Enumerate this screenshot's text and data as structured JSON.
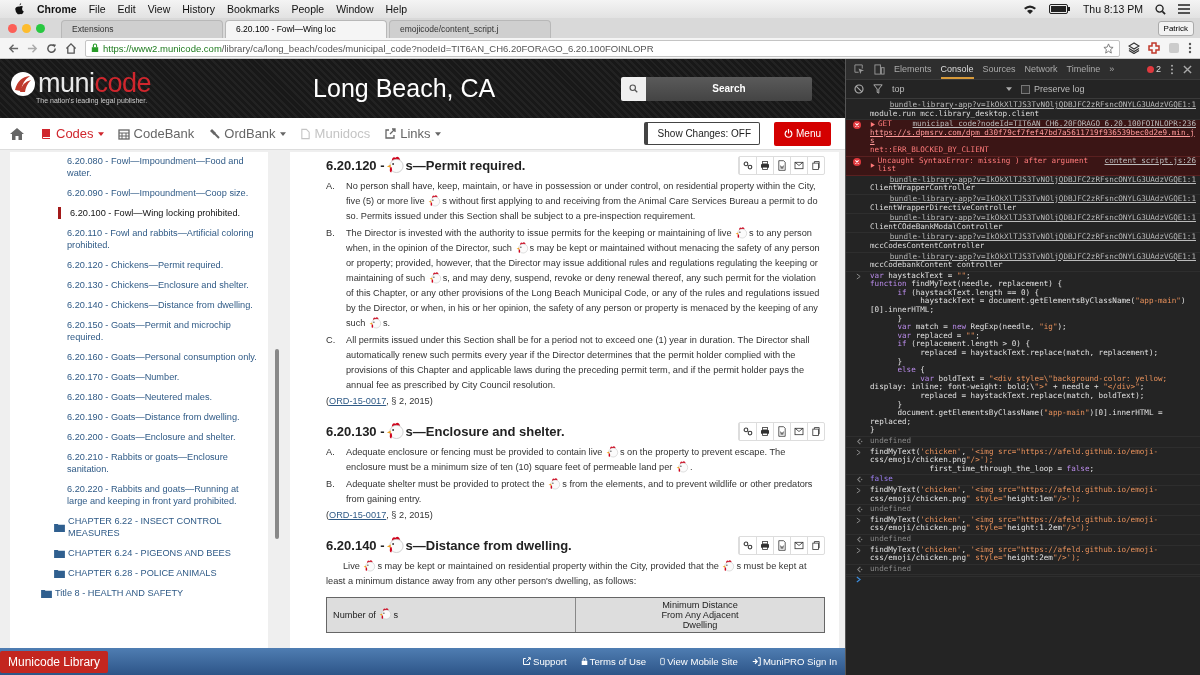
{
  "menu_bar": {
    "app": "Chrome",
    "items": [
      "File",
      "Edit",
      "View",
      "History",
      "Bookmarks",
      "People",
      "Window",
      "Help"
    ],
    "clock": "Thu 8:13 PM"
  },
  "browser": {
    "tabs": [
      {
        "label": "Extensions",
        "selected": false
      },
      {
        "label": "6.20.100 - Fowl—Wing loc",
        "selected": true
      },
      {
        "label": "emojicode/content_script.j",
        "selected": false
      }
    ],
    "profile": "Patrick",
    "url_host": "https://www2.municode.com",
    "url_path": "/library/ca/long_beach/codes/municipal_code?nodeId=TIT6AN_CH6.20FORAGO_6.20.100FOINLOPR"
  },
  "site": {
    "logo_a": "muni",
    "logo_b": "code",
    "tagline": "The nation's leading legal publisher.",
    "title": "Long Beach, CA",
    "search_button": "Search",
    "nav": [
      {
        "label": "Codes",
        "kind": "book",
        "disabled": false,
        "dropdown": true,
        "active": true
      },
      {
        "label": "CodeBank",
        "kind": "calendar",
        "disabled": false,
        "dropdown": false,
        "active": false
      },
      {
        "label": "OrdBank",
        "kind": "gavel",
        "disabled": false,
        "dropdown": true,
        "active": false
      },
      {
        "label": "Munidocs",
        "kind": "file",
        "disabled": true,
        "dropdown": false,
        "active": false
      },
      {
        "label": "Links",
        "kind": "link",
        "disabled": false,
        "dropdown": true,
        "active": false
      }
    ],
    "show_changes": "Show Changes: OFF",
    "menu_button": "Menu",
    "sidebar": [
      {
        "kind": "section",
        "label": "6.20.080 - Fowl—Impoundment—Food and water.",
        "selected": false
      },
      {
        "kind": "section",
        "label": "6.20.090 - Fowl—Impoundment—Coop size.",
        "selected": false
      },
      {
        "kind": "section",
        "label": "6.20.100 - Fowl—Wing locking prohibited.",
        "selected": true
      },
      {
        "kind": "section",
        "label": "6.20.110 - Fowl and rabbits—Artificial coloring prohibited.",
        "selected": false
      },
      {
        "kind": "section",
        "label": "6.20.120 - Chickens—Permit required.",
        "selected": false
      },
      {
        "kind": "section",
        "label": "6.20.130 - Chickens—Enclosure and shelter.",
        "selected": false
      },
      {
        "kind": "section",
        "label": "6.20.140 - Chickens—Distance from dwelling.",
        "selected": false
      },
      {
        "kind": "section",
        "label": "6.20.150 - Goats—Permit and microchip required.",
        "selected": false
      },
      {
        "kind": "section",
        "label": "6.20.160 - Goats—Personal consumption only.",
        "selected": false
      },
      {
        "kind": "section",
        "label": "6.20.170 - Goats—Number.",
        "selected": false
      },
      {
        "kind": "section",
        "label": "6.20.180 - Goats—Neutered males.",
        "selected": false
      },
      {
        "kind": "section",
        "label": "6.20.190 - Goats—Distance from dwelling.",
        "selected": false
      },
      {
        "kind": "section",
        "label": "6.20.200 - Goats—Enclosure and shelter.",
        "selected": false
      },
      {
        "kind": "section",
        "label": "6.20.210 - Rabbits or goats—Enclosure sanitation.",
        "selected": false
      },
      {
        "kind": "section",
        "label": "6.20.220 - Rabbits and goats—Running at large and keeping in front yard prohibited.",
        "selected": false
      },
      {
        "kind": "chapter",
        "label": "CHAPTER 6.22 - INSECT CONTROL MEASURES",
        "selected": false
      },
      {
        "kind": "chapter",
        "label": "CHAPTER 6.24 - PIGEONS AND BEES",
        "selected": false
      },
      {
        "kind": "chapter",
        "label": "CHAPTER 6.28 - POLICE ANIMALS",
        "selected": false
      },
      {
        "kind": "title",
        "label": "Title 8 - HEALTH AND SAFETY",
        "selected": false
      }
    ],
    "sections": [
      {
        "heading": [
          "6.20.120 - ",
          "s—Permit required."
        ],
        "paragraphs": [
          {
            "letter": "A.",
            "parts": [
              "No person shall have, keep, maintain, or have in possession or under control, on residential property within the City, five (5) or more live ",
              "s without first applying to and receiving from the Animal Care Services Bureau a permit to do so. Permits issued under this Section shall be subject to a pre-inspection requirement."
            ]
          },
          {
            "letter": "B.",
            "parts": [
              "The Director is invested with the authority to issue permits for the keeping or maintaining of live ",
              "s to any person when, in the opinion of the Director, such ",
              "s may be kept or maintained without menacing the safety of any person or property; provided, however, that the Director may issue additional rules and regulations regulating the keeping or maintaining of such ",
              "s, and may deny, suspend, revoke or deny renewal thereof, any such permit for the violation of this Chapter, or any other provisions of the Long Beach Municipal Code, or any of the rules and regulations issued by the Director, or when, in his or her opinion, the safety of any person or property is menaced by the keeping of any such ",
              "s."
            ]
          },
          {
            "letter": "C.",
            "parts": [
              "All permits issued under this Section shall be for a period not to exceed one (1) year in duration. The Director shall automatically renew such permits every year if the Director determines that the permit holder complied with the provisions of this Chapter and applicable laws during the preceding permit term, and if the permit holder pays the annual fee as prescribed by City Council resolution."
            ]
          }
        ],
        "citation": {
          "open": "(",
          "link": "ORD-15-0017",
          "rest": ", § 2, 2015)"
        }
      },
      {
        "heading": [
          "6.20.130 - ",
          "s—Enclosure and shelter."
        ],
        "paragraphs": [
          {
            "letter": "A.",
            "parts": [
              "Adequate enclosure or fencing must be provided to contain live ",
              "s on the property to prevent escape. The enclosure must be a minimum size of ten (10) square feet of permeable land per ",
              "."
            ]
          },
          {
            "letter": "B.",
            "parts": [
              "Adequate shelter must be provided to protect the ",
              "s from the elements, and to prevent wildlife or other predators from gaining entry."
            ]
          }
        ],
        "citation": {
          "open": "(",
          "link": "ORD-15-0017",
          "rest": ", § 2, 2015)"
        }
      },
      {
        "heading": [
          "6.20.140 - ",
          "s—Distance from dwelling."
        ],
        "intro": [
          "Live ",
          "s may be kept or maintained on residential property within the City, provided that the ",
          "s must be kept at least a minimum distance away from any other person's dwelling, as follows:"
        ],
        "table_header": [
          [
            "Number of ",
            "s"
          ],
          [
            "Minimum Distance From Any Adjacent Dwelling"
          ]
        ]
      }
    ],
    "footer": {
      "brand": "Municode Library",
      "links": [
        {
          "label": "Support",
          "kind": "external"
        },
        {
          "label": "Terms of Use",
          "kind": "lock"
        },
        {
          "label": "View Mobile Site",
          "kind": "phone"
        },
        {
          "label": "MuniPRO Sign In",
          "kind": "signin"
        }
      ]
    }
  },
  "devtools": {
    "tabs": [
      {
        "label": "Elements",
        "selected": false
      },
      {
        "label": "Console",
        "selected": true
      },
      {
        "label": "Sources",
        "selected": false
      },
      {
        "label": "Network",
        "selected": false
      },
      {
        "label": "Timeline",
        "selected": false
      }
    ],
    "more": "»",
    "error_count": "2",
    "context": "top",
    "preserve_log": {
      "label": "Preserve log",
      "checked": false
    },
    "console": [
      {
        "kind": "log",
        "source": "bundle-library-app?v=IkOkXlTJS3TvNOljQDBJFC2zRFsncONYLG3UAdzVGQE1:1",
        "text": "module.run mcc.library_desktop.client"
      },
      {
        "kind": "error",
        "text": "GET",
        "source": "municipal_code?nodeId=TIT6AN_CH6.20FORAGO_6.20.100FOINLOPR:236",
        "url": "https://s.dpmsrv.com/dpm_d30f79cf7fef47bd7a5611719f936539bec0d2e9.min.js",
        "message": "net::ERR_BLOCKED_BY_CLIENT"
      },
      {
        "kind": "error",
        "text": "Uncaught SyntaxError: missing ) after argument list",
        "source": "content_script.js:26"
      },
      {
        "kind": "log",
        "source": "bundle-library-app?v=IkOkXlTJS3TvNOljQDBJFC2zRFsncONYLG3UAdzVGQE1:1",
        "text": "ClientWrapperController"
      },
      {
        "kind": "log",
        "source": "bundle-library-app?v=IkOkXlTJS3TvNOljQDBJFC2zRFsncONYLG3UAdzVGQE1:1",
        "text": "ClientWrapperDirectiveController"
      },
      {
        "kind": "log",
        "source": "bundle-library-app?v=IkOkXlTJS3TvNOljQDBJFC2zRFsncONYLG3UAdzVGQE1:1",
        "text": "ClientCOdeBankModalController"
      },
      {
        "kind": "log",
        "source": "bundle-library-app?v=IkOkXlTJS3TvNOljQDBJFC2zRFsncONYLG3UAdzVGQE1:1",
        "text": "mccCodesContentController"
      },
      {
        "kind": "log",
        "source": "bundle-library-app?v=IkOkXlTJS3TvNOljQDBJFC2zRFsncONYLG3UAdzVGQE1:1",
        "text": "mccCodebankContent controller"
      },
      {
        "kind": "input",
        "lines": [
          "var haystackText = \"\";",
          "function findMyText(needle, replacement) {",
          "      if (haystackText.length == 0) {",
          "           haystackText = document.getElementsByClassName(\"app-main\")",
          "[0].innerHTML;",
          "      }",
          "      var match = new RegExp(needle, \"ig\");",
          "      var replaced = \"\";",
          "      if (replacement.length > 0) {",
          "           replaced = haystackText.replace(match, replacement);",
          "      }",
          "      else {",
          "           var boldText = \"<div style=\\\"background-color: yellow;",
          "display: inline; font-weight: bold;\\\">\" + needle + \"</div>\";",
          "           replaced = haystackText.replace(match, boldText);",
          "      }",
          "      document.getElementsByClassName(\"app-main\")[0].innerHTML =",
          "replaced;",
          "}"
        ]
      },
      {
        "kind": "result",
        "text": "undefined"
      },
      {
        "kind": "input",
        "lines": [
          "findMyText('chicken', '<img src=\"https://afeld.github.io/emoji-",
          "css/emoji/chicken.png\"/>');",
          "             first_time_through_the_loop = false;"
        ]
      },
      {
        "kind": "value",
        "text": "false"
      },
      {
        "kind": "input",
        "lines": [
          "findMyText('chicken', '<img src=\"https://afeld.github.io/emoji-",
          "css/emoji/chicken.png\" style=\"height:1em\"/>');"
        ]
      },
      {
        "kind": "result",
        "text": "undefined"
      },
      {
        "kind": "input",
        "lines": [
          "findMyText('chicken', '<img src=\"https://afeld.github.io/emoji-",
          "css/emoji/chicken.png\" style=\"height:1.2em\"/>');"
        ]
      },
      {
        "kind": "result",
        "text": "undefined"
      },
      {
        "kind": "input",
        "lines": [
          "findMyText('chicken', '<img src=\"https://afeld.github.io/emoji-",
          "css/emoji/chicken.png\" style=\"height:2em\"/>');"
        ]
      },
      {
        "kind": "result",
        "text": "undefined"
      },
      {
        "kind": "prompt"
      }
    ]
  }
}
